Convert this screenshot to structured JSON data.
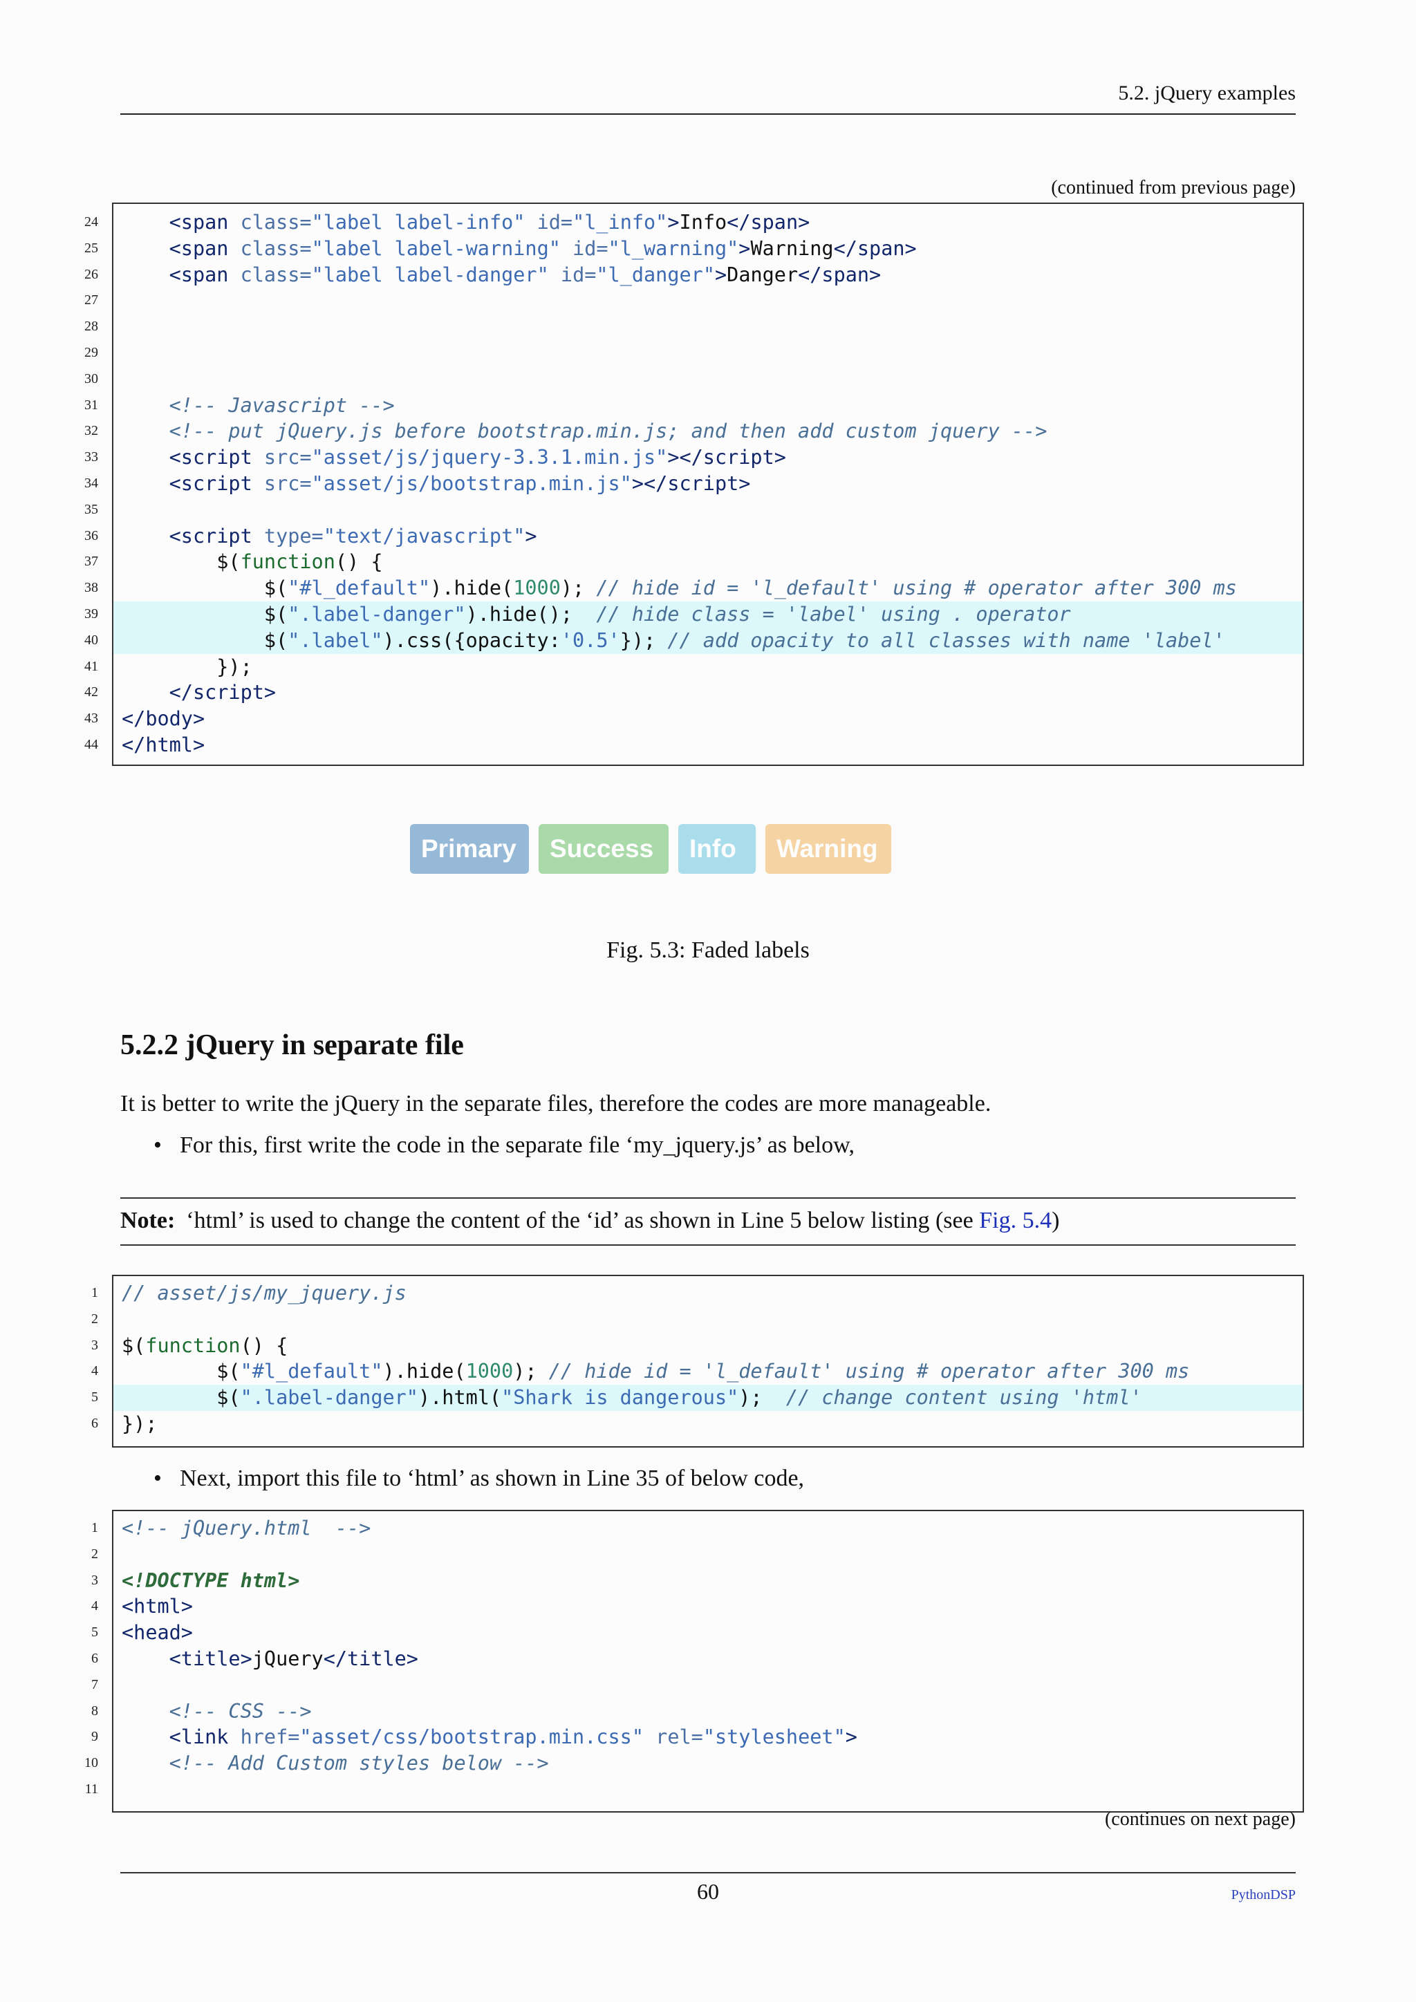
{
  "header": {
    "running_title": "5.2.  jQuery examples"
  },
  "continued_from": "(continued from previous page)",
  "code_block_1": {
    "lines": [
      {
        "n": "24",
        "hl": false,
        "html": "    <span class=\"tag\">&lt;span</span> <span class=\"attr\">class=</span><span class=\"str\">\"label label-info\"</span> <span class=\"attr\">id=</span><span class=\"str\">\"l_info\"</span><span class=\"tag\">&gt;</span>Info<span class=\"tag\">&lt;/span&gt;</span>"
      },
      {
        "n": "25",
        "hl": false,
        "html": "    <span class=\"tag\">&lt;span</span> <span class=\"attr\">class=</span><span class=\"str\">\"label label-warning\"</span> <span class=\"attr\">id=</span><span class=\"str\">\"l_warning\"</span><span class=\"tag\">&gt;</span>Warning<span class=\"tag\">&lt;/span&gt;</span>"
      },
      {
        "n": "26",
        "hl": false,
        "html": "    <span class=\"tag\">&lt;span</span> <span class=\"attr\">class=</span><span class=\"str\">\"label label-danger\"</span> <span class=\"attr\">id=</span><span class=\"str\">\"l_danger\"</span><span class=\"tag\">&gt;</span>Danger<span class=\"tag\">&lt;/span&gt;</span>"
      },
      {
        "n": "27",
        "hl": false,
        "html": ""
      },
      {
        "n": "28",
        "hl": false,
        "html": ""
      },
      {
        "n": "29",
        "hl": false,
        "html": ""
      },
      {
        "n": "30",
        "hl": false,
        "html": ""
      },
      {
        "n": "31",
        "hl": false,
        "html": "    <span class=\"com\">&lt;!-- Javascript --&gt;</span>"
      },
      {
        "n": "32",
        "hl": false,
        "html": "    <span class=\"com\">&lt;!-- put jQuery.js before bootstrap.min.js; and then add custom jquery --&gt;</span>"
      },
      {
        "n": "33",
        "hl": false,
        "html": "    <span class=\"tag\">&lt;script</span> <span class=\"attr\">src=</span><span class=\"str\">\"asset/js/jquery-3.3.1.min.js\"</span><span class=\"tag\">&gt;&lt;/script&gt;</span>"
      },
      {
        "n": "34",
        "hl": false,
        "html": "    <span class=\"tag\">&lt;script</span> <span class=\"attr\">src=</span><span class=\"str\">\"asset/js/bootstrap.min.js\"</span><span class=\"tag\">&gt;&lt;/script&gt;</span>"
      },
      {
        "n": "35",
        "hl": false,
        "html": ""
      },
      {
        "n": "36",
        "hl": false,
        "html": "    <span class=\"tag\">&lt;script</span> <span class=\"attr\">type=</span><span class=\"str\">\"text/javascript\"</span><span class=\"tag\">&gt;</span>"
      },
      {
        "n": "37",
        "hl": false,
        "html": "        $(<span class=\"kw\">function</span>() {"
      },
      {
        "n": "38",
        "hl": false,
        "html": "            $(<span class=\"str\">\"#l_default\"</span>).hide(<span class=\"num\">1000</span>); <span class=\"com\">// hide id = 'l_default' using # operator after 300 ms</span>"
      },
      {
        "n": "39",
        "hl": true,
        "html": "            $(<span class=\"str\">\".label-danger\"</span>).hide();  <span class=\"com\">// hide class = 'label' using . operator</span>"
      },
      {
        "n": "40",
        "hl": true,
        "html": "            $(<span class=\"str\">\".label\"</span>).css({opacity:<span class=\"str\">'0.5'</span>}); <span class=\"com\">// add opacity to all classes with name 'label'</span>"
      },
      {
        "n": "41",
        "hl": false,
        "html": "        });"
      },
      {
        "n": "42",
        "hl": false,
        "html": "    <span class=\"tag\">&lt;/script&gt;</span>"
      },
      {
        "n": "43",
        "hl": false,
        "html": "<span class=\"tag\">&lt;/body&gt;</span>"
      },
      {
        "n": "44",
        "hl": false,
        "html": "<span class=\"tag\">&lt;/html&gt;</span>"
      }
    ]
  },
  "figure": {
    "labels": [
      {
        "text": "Primary",
        "variant": "primary"
      },
      {
        "text": "Success",
        "variant": "success"
      },
      {
        "text": "Info",
        "variant": "info"
      },
      {
        "text": "Warning",
        "variant": "warning"
      }
    ],
    "caption": "Fig. 5.3: Faded labels"
  },
  "section": {
    "title": "5.2.2  jQuery in separate file",
    "intro": "It is better to write the jQuery in the separate files, therefore the codes are more manageable.",
    "bullet_1": "For this, first write the code in the separate file ‘my_jquery.js’ as below,"
  },
  "note": {
    "label": "Note:",
    "text": "‘html’ is used to change the content of the ‘id’ as shown in Line 5 below listing (see ",
    "link_text": "Fig. 5.4",
    "text_end": ")"
  },
  "code_block_2": {
    "lines": [
      {
        "n": "1",
        "hl": false,
        "html": "<span class=\"com\">// asset/js/my_jquery.js</span>"
      },
      {
        "n": "2",
        "hl": false,
        "html": ""
      },
      {
        "n": "3",
        "hl": false,
        "html": "$(<span class=\"kw\">function</span>() {"
      },
      {
        "n": "4",
        "hl": false,
        "html": "        $(<span class=\"str\">\"#l_default\"</span>).hide(<span class=\"num\">1000</span>); <span class=\"com\">// hide id = 'l_default' using # operator after 300 ms</span>"
      },
      {
        "n": "5",
        "hl": true,
        "html": "        $(<span class=\"str\">\".label-danger\"</span>).html(<span class=\"str\">\"Shark is dangerous\"</span>);  <span class=\"com\">// change content using 'html'</span>"
      },
      {
        "n": "6",
        "hl": false,
        "html": "});"
      }
    ]
  },
  "bullet_2": "Next, import this file to ‘html’ as shown in Line 35 of below code,",
  "code_block_3": {
    "lines": [
      {
        "n": "1",
        "hl": false,
        "html": "<span class=\"com\">&lt;!-- jQuery.html  --&gt;</span>"
      },
      {
        "n": "2",
        "hl": false,
        "html": ""
      },
      {
        "n": "3",
        "hl": false,
        "html": "<span class=\"doc\">&lt;!DOCTYPE html&gt;</span>"
      },
      {
        "n": "4",
        "hl": false,
        "html": "<span class=\"tag\">&lt;html&gt;</span>"
      },
      {
        "n": "5",
        "hl": false,
        "html": "<span class=\"tag\">&lt;head&gt;</span>"
      },
      {
        "n": "6",
        "hl": false,
        "html": "    <span class=\"tag\">&lt;title&gt;</span>jQuery<span class=\"tag\">&lt;/title&gt;</span>"
      },
      {
        "n": "7",
        "hl": false,
        "html": ""
      },
      {
        "n": "8",
        "hl": false,
        "html": "    <span class=\"com\">&lt;!-- CSS --&gt;</span>"
      },
      {
        "n": "9",
        "hl": false,
        "html": "    <span class=\"tag\">&lt;link</span> <span class=\"attr\">href=</span><span class=\"str\">\"asset/css/bootstrap.min.css\"</span> <span class=\"attr\">rel=</span><span class=\"str\">\"stylesheet\"</span><span class=\"tag\">&gt;</span>"
      },
      {
        "n": "10",
        "hl": false,
        "html": "    <span class=\"com\">&lt;!-- Add Custom styles below --&gt;</span>"
      },
      {
        "n": "11",
        "hl": false,
        "html": ""
      }
    ]
  },
  "continues_on": "(continues on next page)",
  "footer": {
    "page_number": "60",
    "brand": "PythonDSP"
  }
}
